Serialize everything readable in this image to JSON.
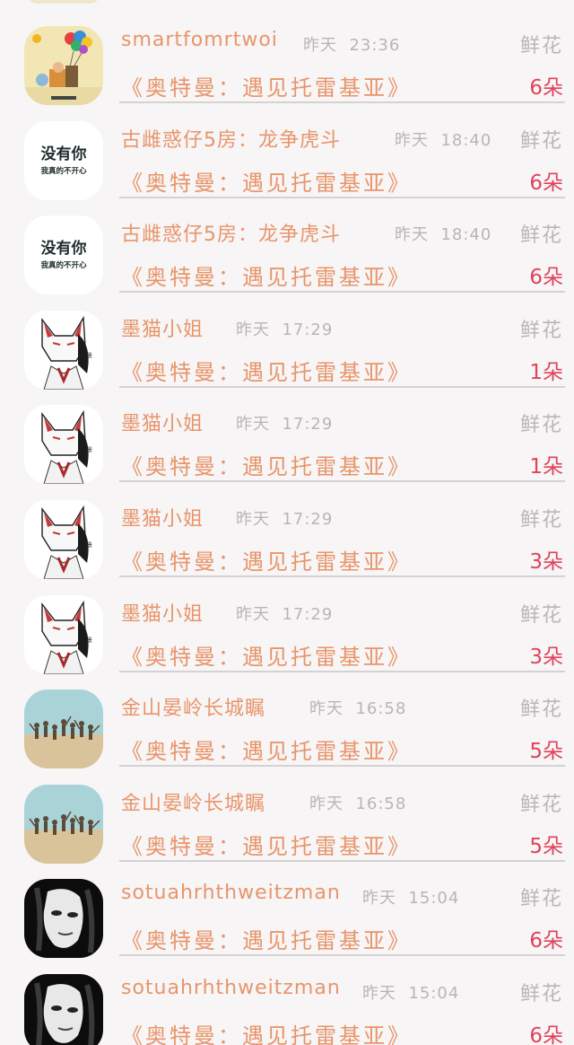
{
  "rows": [
    {
      "name": "smartfomrtwoi",
      "day": "昨天",
      "time": "23:36",
      "gift": "鲜花",
      "book": "《奥特曼：遇见托雷基亚》",
      "count": "6朵",
      "avatar": "balloon-cartoon"
    },
    {
      "name": "古雌惑仔5房：龙争虎斗",
      "day": "昨天",
      "time": "18:40",
      "gift": "鲜花",
      "book": "《奥特曼：遇见托雷基亚》",
      "count": "6朵",
      "avatar": "text-mei-you-ni",
      "avatar_text": "没有你",
      "avatar_subtext": "我真的不开心"
    },
    {
      "name": "古雌惑仔5房：龙争虎斗",
      "day": "昨天",
      "time": "18:40",
      "gift": "鲜花",
      "book": "《奥特曼：遇见托雷基亚》",
      "count": "6朵",
      "avatar": "text-mei-you-ni",
      "avatar_text": "没有你",
      "avatar_subtext": "我真的不开心"
    },
    {
      "name": "墨猫小姐",
      "day": "昨天",
      "time": "17:29",
      "gift": "鲜花",
      "book": "《奥特曼：遇见托雷基亚》",
      "count": "1朵",
      "avatar": "fox-mask"
    },
    {
      "name": "墨猫小姐",
      "day": "昨天",
      "time": "17:29",
      "gift": "鲜花",
      "book": "《奥特曼：遇见托雷基亚》",
      "count": "1朵",
      "avatar": "fox-mask"
    },
    {
      "name": "墨猫小姐",
      "day": "昨天",
      "time": "17:29",
      "gift": "鲜花",
      "book": "《奥特曼：遇见托雷基亚》",
      "count": "3朵",
      "avatar": "fox-mask"
    },
    {
      "name": "墨猫小姐",
      "day": "昨天",
      "time": "17:29",
      "gift": "鲜花",
      "book": "《奥特曼：遇见托雷基亚》",
      "count": "3朵",
      "avatar": "fox-mask"
    },
    {
      "name": "金山晏岭长城瞩",
      "day": "昨天",
      "time": "16:58",
      "gift": "鲜花",
      "book": "《奥特曼：遇见托雷基亚》",
      "count": "5朵",
      "avatar": "beach-group"
    },
    {
      "name": "金山晏岭长城瞩",
      "day": "昨天",
      "time": "16:58",
      "gift": "鲜花",
      "book": "《奥特曼：遇见托雷基亚》",
      "count": "5朵",
      "avatar": "beach-group"
    },
    {
      "name": "sotuahrhthweitzman",
      "day": "昨天",
      "time": "15:04",
      "gift": "鲜花",
      "book": "《奥特曼：遇见托雷基亚》",
      "count": "6朵",
      "avatar": "mask-face"
    },
    {
      "name": "sotuahrhthweitzman",
      "day": "昨天",
      "time": "15:04",
      "gift": "鲜花",
      "book": "《奥特曼：遇见托雷基亚》",
      "count": "6朵",
      "avatar": "mask-face"
    }
  ]
}
